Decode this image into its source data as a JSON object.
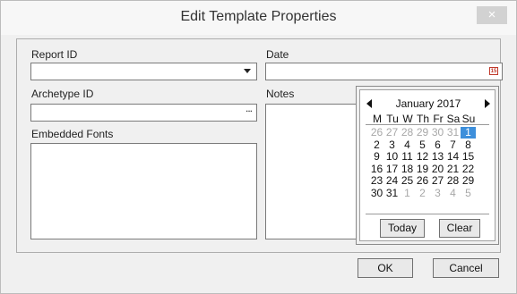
{
  "dialog": {
    "title": "Edit Template Properties",
    "close_label": "×"
  },
  "fields": {
    "report_id_label": "Report ID",
    "report_id_value": "",
    "date_label": "Date",
    "date_value": "",
    "archetype_id_label": "Archetype ID",
    "archetype_id_value": "",
    "archetype_browse": "...",
    "notes_label": "Notes",
    "embedded_fonts_label": "Embedded Fonts",
    "calendar_icon_text": "15"
  },
  "calendar": {
    "month_year": "January 2017",
    "weekdays": [
      "M",
      "Tu",
      "W",
      "Th",
      "Fr",
      "Sa",
      "Su"
    ],
    "weeks": [
      [
        "26",
        "27",
        "28",
        "29",
        "30",
        "31",
        "1"
      ],
      [
        "2",
        "3",
        "4",
        "5",
        "6",
        "7",
        "8"
      ],
      [
        "9",
        "10",
        "11",
        "12",
        "13",
        "14",
        "15"
      ],
      [
        "16",
        "17",
        "18",
        "19",
        "20",
        "21",
        "22"
      ],
      [
        "23",
        "24",
        "25",
        "26",
        "27",
        "28",
        "29"
      ],
      [
        "30",
        "31",
        "1",
        "2",
        "3",
        "4",
        "5"
      ]
    ],
    "selected_day": "1",
    "today_label": "Today",
    "clear_label": "Clear"
  },
  "buttons": {
    "ok_label": "OK",
    "cancel_label": "Cancel"
  },
  "colors": {
    "selected_day_bg": "#3d8fdb",
    "other_month_text": "#a8a8a8",
    "calendar_icon": "#c0392b"
  }
}
